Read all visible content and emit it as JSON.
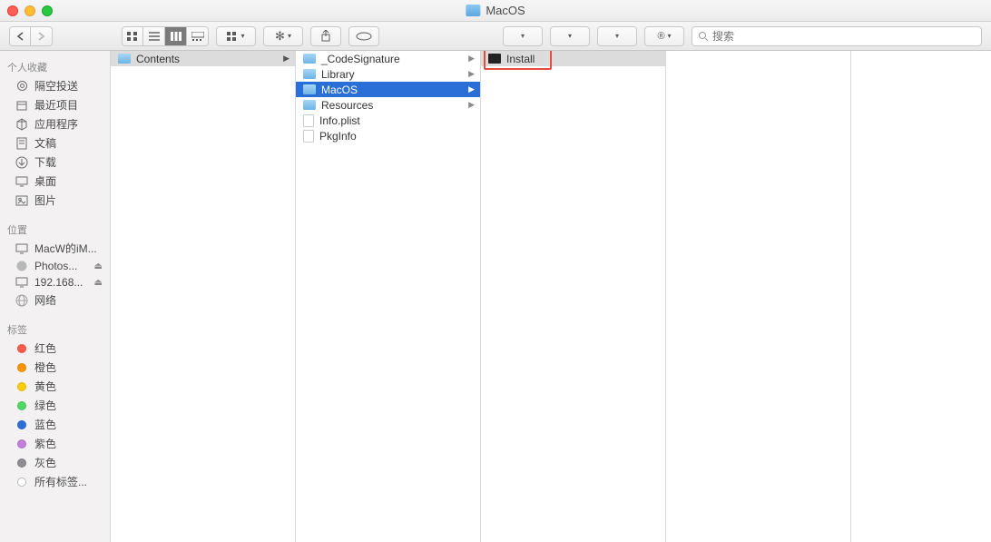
{
  "window": {
    "title": "MacOS"
  },
  "toolbar": {
    "search_placeholder": "搜索"
  },
  "sidebar": {
    "favorites_header": "个人收藏",
    "favorites": [
      {
        "label": "隔空投送",
        "icon": "airdrop"
      },
      {
        "label": "最近项目",
        "icon": "recent"
      },
      {
        "label": "应用程序",
        "icon": "apps"
      },
      {
        "label": "文稿",
        "icon": "docs"
      },
      {
        "label": "下载",
        "icon": "downloads"
      },
      {
        "label": "桌面",
        "icon": "desktop"
      },
      {
        "label": "图片",
        "icon": "pictures"
      }
    ],
    "locations_header": "位置",
    "locations": [
      {
        "label": "MacW的iM...",
        "icon": "computer",
        "eject": false
      },
      {
        "label": "Photos...",
        "icon": "disk",
        "eject": true
      },
      {
        "label": "192.168...",
        "icon": "server",
        "eject": true
      },
      {
        "label": "网络",
        "icon": "network",
        "eject": false
      }
    ],
    "tags_header": "标签",
    "tags": [
      {
        "label": "红色",
        "color": "#ff5b4c"
      },
      {
        "label": "橙色",
        "color": "#ff9500"
      },
      {
        "label": "黄色",
        "color": "#ffcc00"
      },
      {
        "label": "绿色",
        "color": "#4cd964"
      },
      {
        "label": "蓝色",
        "color": "#2a6fd8"
      },
      {
        "label": "紫色",
        "color": "#c080dc"
      },
      {
        "label": "灰色",
        "color": "#8e8e93"
      },
      {
        "label": "所有标签...",
        "color": null
      }
    ]
  },
  "columns": [
    {
      "items": [
        {
          "label": "Contents",
          "type": "folder",
          "hasChildren": true,
          "selected": "light"
        }
      ]
    },
    {
      "items": [
        {
          "label": "_CodeSignature",
          "type": "folder",
          "hasChildren": true
        },
        {
          "label": "Library",
          "type": "folder",
          "hasChildren": true
        },
        {
          "label": "MacOS",
          "type": "folder",
          "hasChildren": true,
          "selected": "blue"
        },
        {
          "label": "Resources",
          "type": "folder",
          "hasChildren": true
        },
        {
          "label": "Info.plist",
          "type": "file"
        },
        {
          "label": "PkgInfo",
          "type": "file"
        }
      ]
    },
    {
      "items": [
        {
          "label": "Install",
          "type": "exec",
          "selected": "light",
          "highlighted": true
        }
      ]
    },
    {
      "items": []
    }
  ]
}
